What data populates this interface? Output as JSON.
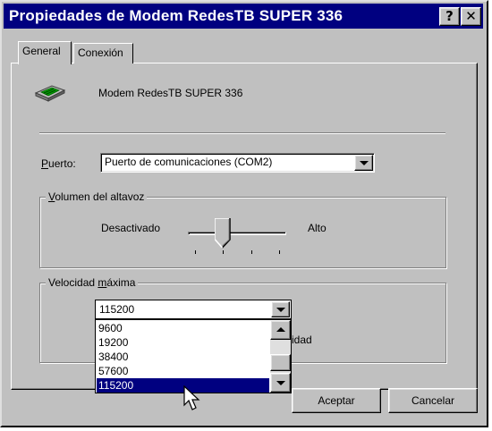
{
  "window": {
    "title": "Propiedades de Modem RedesTB SUPER 336",
    "help_button": "?",
    "close_button": "✕"
  },
  "tabs": [
    {
      "label": "General",
      "active": true
    },
    {
      "label": "Conexión",
      "active": false
    }
  ],
  "general": {
    "modem_name": "Modem RedesTB SUPER 336",
    "modem_icon": "modem-icon",
    "port": {
      "label_underlined": "P",
      "label_rest": "uerto:",
      "value": "Puerto de comunicaciones (COM2)"
    },
    "volume": {
      "group_underlined": "V",
      "group_rest": "olumen del altavoz",
      "low_label": "Desactivado",
      "high_label": "Alto",
      "level_fraction": 0.33,
      "tick_count": 4
    },
    "max_speed": {
      "group_before": "Velocidad ",
      "group_underlined": "m",
      "group_after": "áxima",
      "selected_value": "115200",
      "options": [
        "9600",
        "19200",
        "38400",
        "57600",
        "115200"
      ],
      "selected_index": 4,
      "hidden_text_fragment": "idad"
    }
  },
  "buttons": {
    "ok": "Aceptar",
    "cancel": "Cancelar"
  },
  "colors": {
    "titlebar": "#000080",
    "face": "#c0c0c0",
    "highlight": "#000080"
  }
}
